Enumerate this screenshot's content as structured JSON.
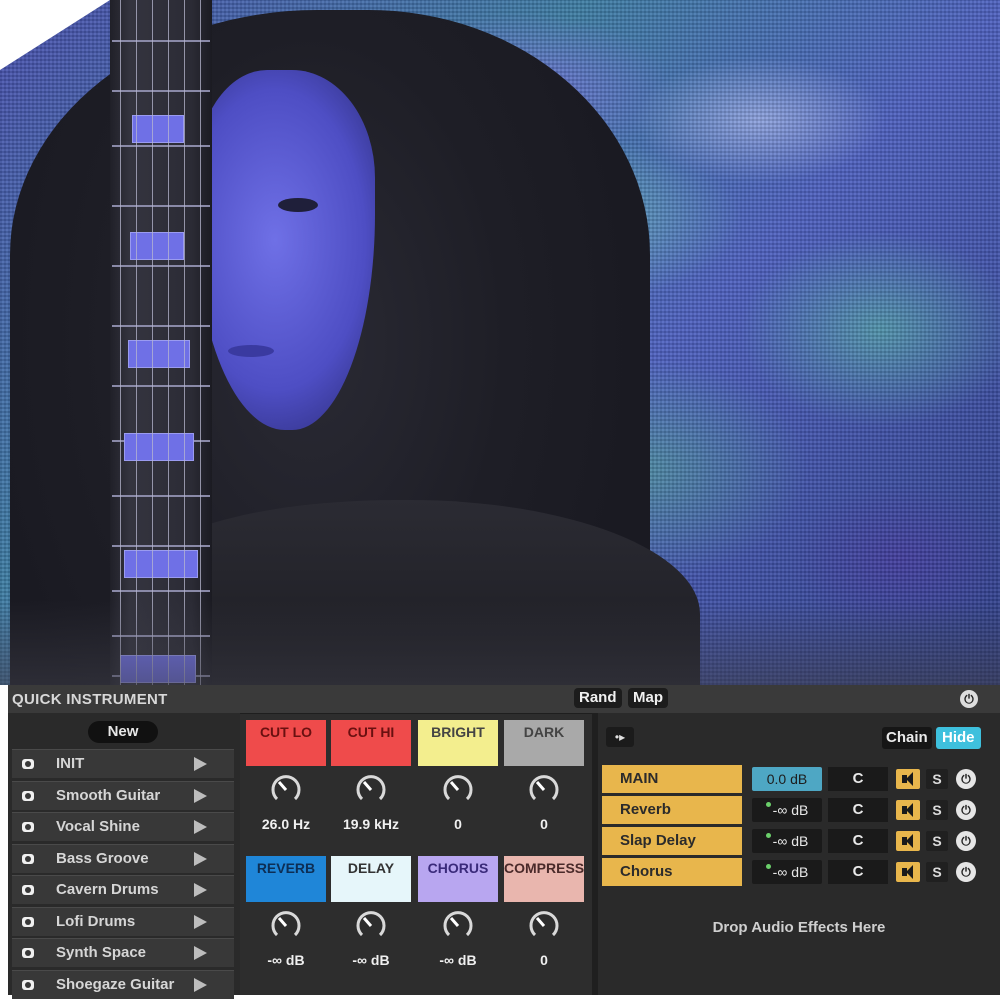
{
  "device": {
    "title": "QUICK INSTRUMENT",
    "rand_label": "Rand",
    "map_label": "Map",
    "new_label": "New"
  },
  "presets": [
    {
      "label": "INIT"
    },
    {
      "label": "Smooth Guitar"
    },
    {
      "label": "Vocal Shine"
    },
    {
      "label": "Bass Groove"
    },
    {
      "label": "Cavern Drums"
    },
    {
      "label": "Lofi Drums"
    },
    {
      "label": "Synth Space"
    },
    {
      "label": "Shoegaze Guitar"
    }
  ],
  "macros": [
    {
      "label": "CUT LO",
      "value": "26.0 Hz",
      "color": "#ef4b4b"
    },
    {
      "label": "CUT HI",
      "value": "19.9 kHz",
      "color": "#ef4b4b"
    },
    {
      "label": "BRIGHT",
      "value": "0",
      "color": "#f3ee8e"
    },
    {
      "label": "DARK",
      "value": "0",
      "color": "#a9a9a9"
    },
    {
      "label": "REVERB",
      "value": "-∞ dB",
      "color": "#1f86d8"
    },
    {
      "label": "DELAY",
      "value": "-∞ dB",
      "color": "#e6f6fa"
    },
    {
      "label": "CHORUS",
      "value": "-∞ dB",
      "color": "#b8a6f0"
    },
    {
      "label": "COMPRESS",
      "value": "0",
      "color": "#e9b6ae"
    }
  ],
  "chain": {
    "chain_label": "Chain",
    "hide_label": "Hide",
    "rows": [
      {
        "name": "MAIN",
        "volume": "0.0 dB",
        "pan": "C",
        "solo": "S"
      },
      {
        "name": "Reverb",
        "volume": "-∞ dB",
        "pan": "C",
        "solo": "S"
      },
      {
        "name": "Slap Delay",
        "volume": "-∞ dB",
        "pan": "C",
        "solo": "S"
      },
      {
        "name": "Chorus",
        "volume": "-∞ dB",
        "pan": "C",
        "solo": "S"
      }
    ],
    "drop_text": "Drop Audio Effects Here"
  },
  "icons": {
    "device_icon": "power-icon",
    "preset_icon": "camera-icon",
    "play_icon": "play-icon",
    "speaker_icon": "speaker-icon",
    "toggle_icon": "arrow-icon"
  }
}
